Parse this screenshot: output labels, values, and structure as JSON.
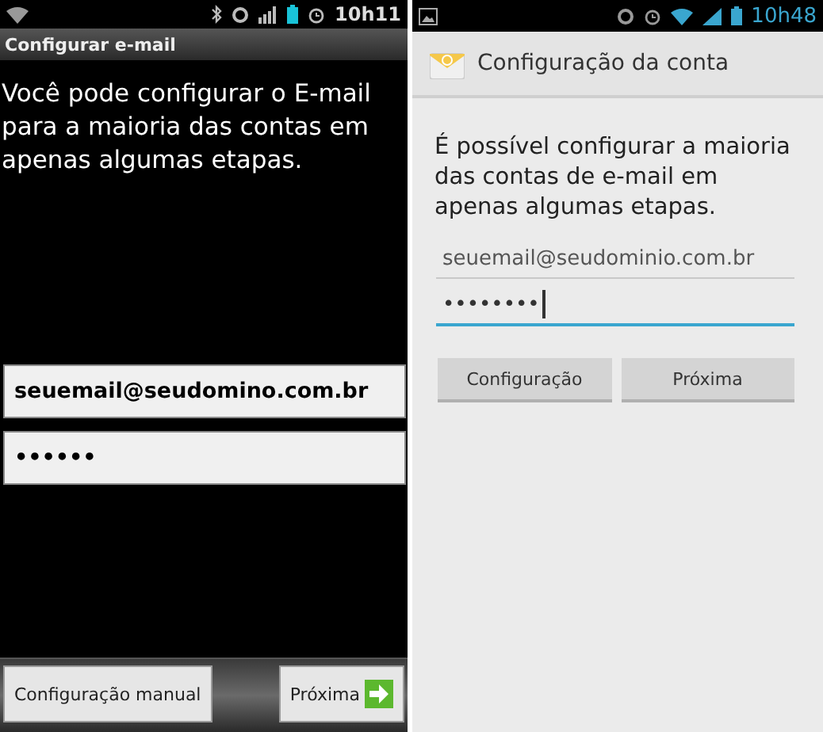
{
  "screens": [
    {
      "kind": "dark",
      "status_bar": {
        "time": "10h11"
      },
      "title": "Configurar e-mail",
      "intro": "Você pode configurar o E-mail para a maioria das contas em apenas algumas etapas.",
      "fields": [
        {
          "value": "seuemail@seudomino.com.br",
          "focused": false
        },
        {
          "value": "••••••",
          "focused": false
        }
      ],
      "buttons": [
        {
          "kind": "plain",
          "label": "Configuração manual"
        },
        {
          "kind": "next",
          "label": "Próxima"
        }
      ]
    },
    {
      "kind": "light",
      "status_bar": {
        "time": "10h48"
      },
      "title": "Configuração da conta",
      "intro": "É possível configurar a maioria das contas de e-mail em apenas algumas etapas.",
      "fields": [
        {
          "value": "seuemail@seudominio.com.br",
          "focused": false
        },
        {
          "value": "••••••••",
          "focused": true
        }
      ],
      "buttons": [
        {
          "kind": "plain",
          "label": "Configuração"
        },
        {
          "kind": "plain",
          "label": "Próxima"
        }
      ]
    }
  ]
}
